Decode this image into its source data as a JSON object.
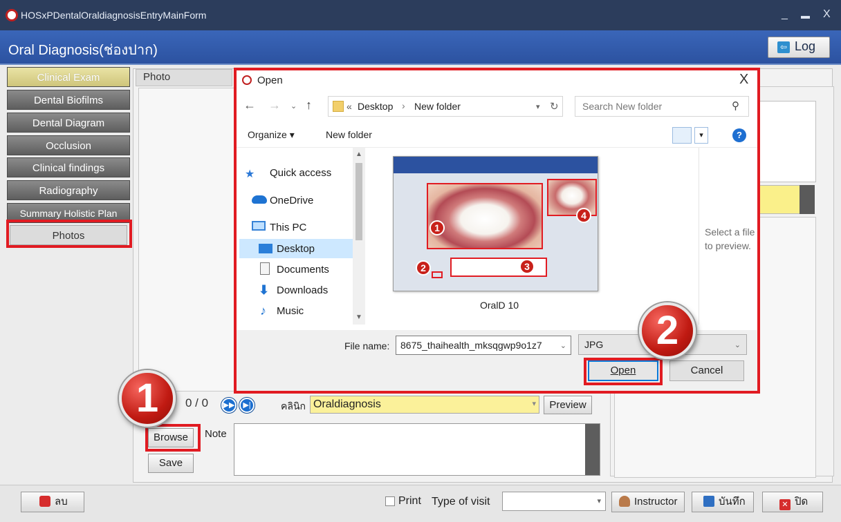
{
  "window": {
    "title": "HOSxPDentalOraldiagnosisEntryMainForm",
    "min_glyph": "_",
    "max_glyph": "▬",
    "close_glyph": "X"
  },
  "header": {
    "title": "Oral Diagnosis(ช่องปาก)",
    "log_label": "Log"
  },
  "sidebar": {
    "items": [
      {
        "label": "Clinical Exam"
      },
      {
        "label": "Dental Biofilms"
      },
      {
        "label": "Dental Diagram"
      },
      {
        "label": "Occlusion"
      },
      {
        "label": "Clinical findings"
      },
      {
        "label": "Radiography"
      },
      {
        "label": "Summary Holistic Plan"
      },
      {
        "label": "Photos"
      }
    ]
  },
  "photo": {
    "tab_label": "Photo",
    "counter": "0 / 0",
    "clinic_label": "คลินิก",
    "clinic_value": "Oraldiagnosis",
    "preview_label": "Preview",
    "browse_label": "Browse",
    "save_label": "Save",
    "note_label": "Note"
  },
  "statusbar": {
    "delete_label": "ลบ",
    "print_label": "Print",
    "type_of_visit_label": "Type of visit",
    "type_of_visit_value": "",
    "instructor_label": "Instructor",
    "save_label": "บันทึก",
    "close_label": "ปิด"
  },
  "callouts": {
    "step1": "1",
    "step2": "2"
  },
  "dialog": {
    "title": "Open",
    "close_glyph": "X",
    "path": [
      "«",
      "Desktop",
      "›",
      "New folder"
    ],
    "search_placeholder": "Search New folder",
    "organize_label": "Organize ▾",
    "new_folder_label": "New folder",
    "nav_items": [
      {
        "label": "Quick access",
        "icon": "star-icon"
      },
      {
        "label": "OneDrive",
        "icon": "cloud-icon"
      },
      {
        "label": "This PC",
        "icon": "monitor-icon"
      },
      {
        "label": "Desktop",
        "icon": "desktop-icon",
        "selected": true
      },
      {
        "label": "Documents",
        "icon": "document-icon"
      },
      {
        "label": "Downloads",
        "icon": "download-icon"
      },
      {
        "label": "Music",
        "icon": "music-icon"
      }
    ],
    "file": {
      "name": "OralD 10",
      "marks": [
        "1",
        "2",
        "3",
        "4"
      ]
    },
    "preview_text": "Select a file to preview.",
    "file_name_label": "File name:",
    "file_name_value": "8675_thaihealth_mksqgwp9o1z7",
    "file_type_value": "JPG",
    "open_label": "Open",
    "cancel_label": "Cancel"
  },
  "colors": {
    "header_blue": "#2c52a0",
    "highlight_red": "#e11b22",
    "clinic_yellow": "#fbf19a"
  }
}
